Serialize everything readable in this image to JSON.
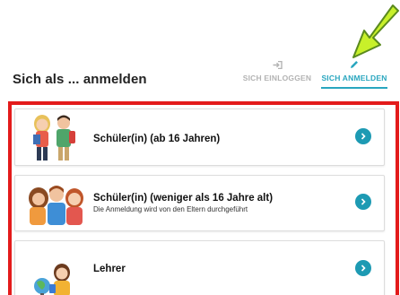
{
  "header": {
    "title": "Sich als ... anmelden"
  },
  "tabs": {
    "login": {
      "label": "SICH EINLOGGEN",
      "icon": "sign-in-icon",
      "active": false
    },
    "register": {
      "label": "SICH ANMELDEN",
      "icon": "pencil-icon",
      "active": true
    }
  },
  "options": [
    {
      "label": "Schüler(in) (ab 16 Jahren)",
      "subtitle": "",
      "icon": "teen-students-illustration"
    },
    {
      "label": "Schüler(in) (weniger als 16 Jahre alt)",
      "subtitle": "Die Anmeldung wird von den Eltern durchgeführt",
      "icon": "young-students-illustration"
    },
    {
      "label": "Lehrer",
      "subtitle": "",
      "icon": "teacher-illustration"
    }
  ],
  "colors": {
    "accent": "#29a6bf",
    "chevron": "#1d9ab3",
    "highlight_frame": "#e31b1b",
    "annotation_arrow": "#c8f02a"
  }
}
